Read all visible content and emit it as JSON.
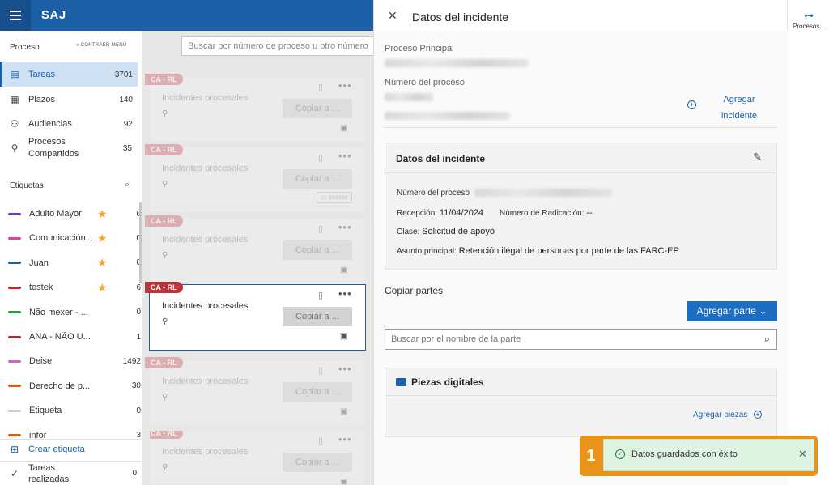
{
  "app": {
    "title": "SAJ"
  },
  "sidebar": {
    "header": "Proceso",
    "collapse": "CONTRAER MENÚ",
    "nav": [
      {
        "label": "Tareas",
        "count": "3701",
        "icon": "tasks-icon"
      },
      {
        "label": "Plazos",
        "count": "140",
        "icon": "calendar-icon"
      },
      {
        "label": "Audiencias",
        "count": "92",
        "icon": "people-icon"
      },
      {
        "label": "Procesos Compartidos",
        "count": "35",
        "icon": "shared-icon"
      }
    ],
    "tags_header": "Etiquetas",
    "tags": [
      {
        "label": "Adulto Mayor",
        "count": "6",
        "color": "#6a3fb5",
        "starred": true
      },
      {
        "label": "Comunicación...",
        "count": "0",
        "color": "#e83ea0",
        "starred": true
      },
      {
        "label": "Juan",
        "count": "0",
        "color": "#1b5fa6",
        "starred": true
      },
      {
        "label": "testek",
        "count": "6",
        "color": "#c0282d",
        "starred": true
      },
      {
        "label": "Não mexer - ...",
        "count": "0",
        "color": "#2a9d3c",
        "starred": false
      },
      {
        "label": "ANA - NÃO U...",
        "count": "1",
        "color": "#b3282d",
        "starred": false
      },
      {
        "label": "Deise",
        "count": "1492",
        "color": "#c96bb8",
        "starred": false
      },
      {
        "label": "Derecho de p...",
        "count": "30",
        "color": "#e8590c",
        "starred": false
      },
      {
        "label": "Etiqueta",
        "count": "0",
        "color": "#cccccc",
        "starred": false
      },
      {
        "label": "infor",
        "count": "3",
        "color": "#e8590c",
        "starred": false
      }
    ],
    "create_tag": "Crear etiqueta",
    "done_tasks": "Tareas realizadas",
    "done_count": "0"
  },
  "main": {
    "search_placeholder": "Buscar por número de proceso u otro número",
    "cards": [
      {
        "tag": "CA - RL",
        "title": "Incidentes procesales",
        "button": "Copiar a ..."
      },
      {
        "tag": "CA - RL",
        "title": "Incidentes procesales",
        "button": "Copiar a ...",
        "badge": "ssssss"
      },
      {
        "tag": "CA - RL",
        "title": "Incidentes procesales",
        "button": "Copiar a ..."
      },
      {
        "tag": "CA - RL",
        "title": "Incidentes procesales",
        "button": "Copiar a ..."
      },
      {
        "tag": "CA - RL",
        "title": "Incidentes procesales",
        "button": "Copiar a ..."
      },
      {
        "tag": "CA - RL",
        "title": "Incidentes procesales",
        "button": "Copiar a ..."
      }
    ]
  },
  "panel": {
    "title": "Datos del incidente",
    "main_process_label": "Proceso Principal",
    "process_number_label": "Número del proceso",
    "add_incident": "Agregar incidente",
    "incident_box": {
      "title": "Datos del incidente",
      "process_number_label": "Número del proceso",
      "reception_label": "Recepción:",
      "reception_value": "11/04/2024",
      "radication_label": "Número de Radicación:",
      "radication_value": "--",
      "class_label": "Clase:",
      "class_value": "Solicitud de apoyo",
      "subject_label": "Asunto principal:",
      "subject_value": "Retención ilegal de personas por parte de las FARC-EP"
    },
    "copy_parties": "Copiar partes",
    "add_party": "Agregar parte",
    "party_search_placeholder": "Buscar por el nombre de la parte",
    "pieces": {
      "title": "Piezas digitales",
      "add": "Agregar piezas"
    }
  },
  "rail": {
    "label": "Procesos ..."
  },
  "toast": {
    "message": "Datos guardados con éxito",
    "callout_number": "1"
  }
}
